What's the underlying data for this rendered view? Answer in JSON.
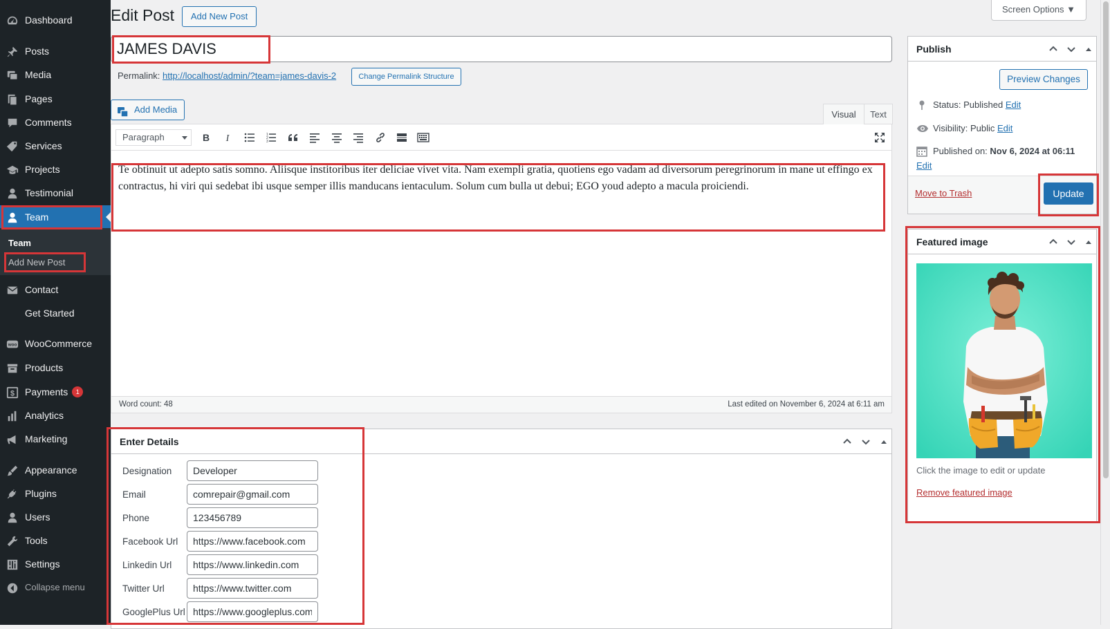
{
  "sidebar": {
    "items": [
      {
        "label": "Dashboard",
        "icon": "dashboard-icon"
      },
      {
        "label": "Posts",
        "icon": "pin-icon"
      },
      {
        "label": "Media",
        "icon": "media-icon"
      },
      {
        "label": "Pages",
        "icon": "pages-icon"
      },
      {
        "label": "Comments",
        "icon": "comment-icon"
      },
      {
        "label": "Services",
        "icon": "tag-icon"
      },
      {
        "label": "Projects",
        "icon": "portfolio-icon"
      },
      {
        "label": "Testimonial",
        "icon": "user-icon"
      },
      {
        "label": "Team",
        "icon": "user-icon"
      },
      {
        "label": "Contact",
        "icon": "envelope-icon"
      },
      {
        "label": "Get Started",
        "icon": ""
      },
      {
        "label": "WooCommerce",
        "icon": "woo-icon"
      },
      {
        "label": "Products",
        "icon": "archive-icon"
      },
      {
        "label": "Payments",
        "icon": "dollar-icon",
        "badge": "1"
      },
      {
        "label": "Analytics",
        "icon": "bar-chart-icon"
      },
      {
        "label": "Marketing",
        "icon": "megaphone-icon"
      },
      {
        "label": "Appearance",
        "icon": "brush-icon"
      },
      {
        "label": "Plugins",
        "icon": "plug-icon"
      },
      {
        "label": "Users",
        "icon": "user-icon"
      },
      {
        "label": "Tools",
        "icon": "wrench-icon"
      },
      {
        "label": "Settings",
        "icon": "sliders-icon"
      },
      {
        "label": "Collapse menu",
        "icon": "collapse-icon"
      }
    ],
    "submenu": {
      "title": "Team",
      "items": [
        "Add New Post"
      ]
    }
  },
  "header": {
    "title": "Edit Post",
    "add_new_label": "Add New Post",
    "screen_options_label": "Screen Options ▼"
  },
  "post": {
    "title": "JAMES DAVIS",
    "permalink_label": "Permalink:",
    "permalink_url": "http://localhost/admin/?team=james-davis-2",
    "change_permalink_label": "Change Permalink Structure"
  },
  "editor": {
    "add_media_label": "Add Media",
    "tabs": [
      "Visual",
      "Text"
    ],
    "active_tab": "Visual",
    "format_select": "Paragraph",
    "toolbar_icons": [
      "bold-icon",
      "italic-icon",
      "bullet-list-icon",
      "numbered-list-icon",
      "blockquote-icon",
      "align-left-icon",
      "align-center-icon",
      "align-right-icon",
      "link-icon",
      "read-more-icon",
      "toolbar-toggle-icon",
      "fullscreen-icon"
    ],
    "content": "Te obtinuit ut adepto satis somno. Aliisque institoribus iter deliciae vivet vita. Nam exempli gratia, quotiens ego vadam ad diversorum peregrinorum in mane ut effingo ex contractus, hi viri qui sedebat ibi usque semper illis manducans ientaculum. Solum cum bulla ut debui; EGO youd adepto a macula proiciendi.",
    "word_count": "Word count: 48",
    "last_edited": "Last edited on November 6, 2024 at 6:11 am"
  },
  "details": {
    "title": "Enter Details",
    "fields": [
      {
        "label": "Designation",
        "value": "Developer"
      },
      {
        "label": "Email",
        "value": "comrepair@gmail.com"
      },
      {
        "label": "Phone",
        "value": "123456789"
      },
      {
        "label": "Facebook Url",
        "value": "https://www.facebook.com"
      },
      {
        "label": "Linkedin Url",
        "value": "https://www.linkedin.com"
      },
      {
        "label": "Twitter Url",
        "value": "https://www.twitter.com"
      },
      {
        "label": "GooglePlus Url",
        "value": "https://www.googleplus.com"
      }
    ]
  },
  "publish": {
    "title": "Publish",
    "preview_label": "Preview Changes",
    "status_label": "Status:",
    "status_value": "Published",
    "visibility_label": "Visibility:",
    "visibility_value": "Public",
    "published_label": "Published on:",
    "published_value": "Nov 6, 2024 at 06:11",
    "edit_label": "Edit",
    "trash_label": "Move to Trash",
    "update_label": "Update"
  },
  "featured": {
    "title": "Featured image",
    "hint": "Click the image to edit or update",
    "remove_label": "Remove featured image"
  },
  "colors": {
    "sidebar_bg": "#1d2327",
    "accent": "#2271b1",
    "highlight_box": "#d63638",
    "image_bg": "#5fe3c8"
  }
}
